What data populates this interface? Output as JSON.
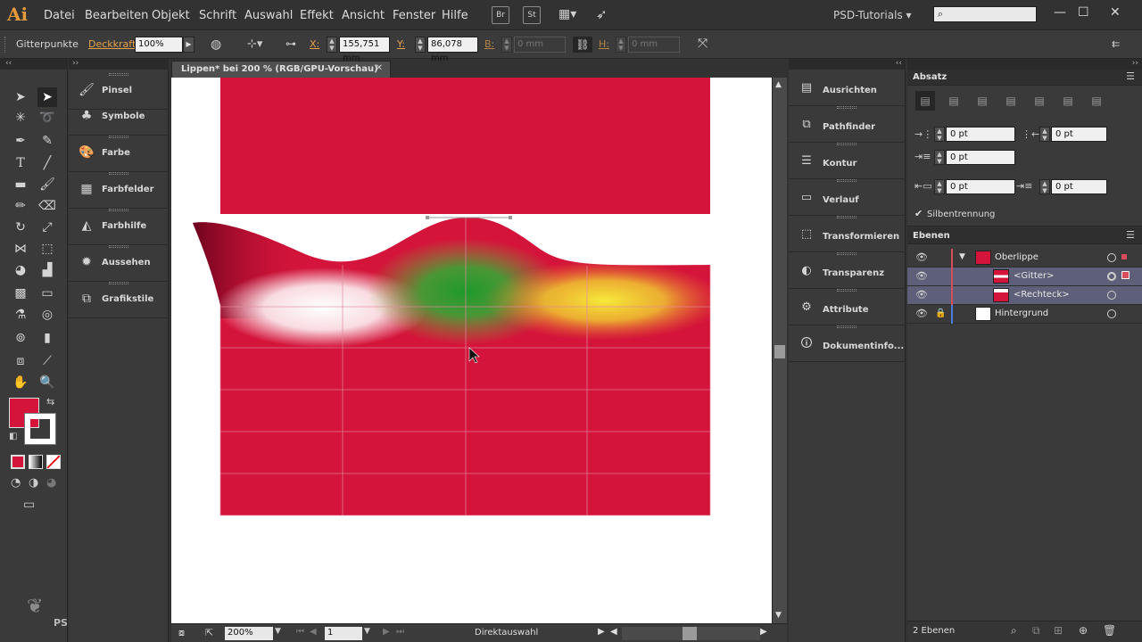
{
  "app": {
    "logo": "Ai",
    "menus": [
      "Datei",
      "Bearbeiten",
      "Objekt",
      "Schrift",
      "Auswahl",
      "Effekt",
      "Ansicht",
      "Fenster",
      "Hilfe"
    ],
    "bridge_icon": "Br",
    "stock_icon": "St",
    "workspace": "PSD-Tutorials",
    "window_controls": [
      "minimize-icon",
      "maximize-icon",
      "close-icon"
    ]
  },
  "control": {
    "selection_label": "Gitterpunkte",
    "opacity_label": "Deckkraft:",
    "opacity_value": "100%",
    "x_label": "X:",
    "x_value": "155,751 mm",
    "y_label": "Y:",
    "y_value": "86,078 mm",
    "w_label": "B:",
    "w_value": "0 mm",
    "h_label": "H:",
    "h_value": "0 mm"
  },
  "document": {
    "tab_title": "Lippen* bei 200 % (RGB/GPU-Vorschau)",
    "zoom": "200%",
    "artboard": "1",
    "status": "Direktauswahl",
    "colors": {
      "red": "#d4143a",
      "green": "#1e9a2a",
      "yellow": "#f2e23a"
    }
  },
  "panels_left": [
    {
      "label": "Pinsel",
      "icon": "brush-icon"
    },
    {
      "label": "Symbole",
      "icon": "symbols-icon"
    },
    {
      "label": "Farbe",
      "icon": "palette-icon"
    },
    {
      "label": "Farbfelder",
      "icon": "swatches-icon"
    },
    {
      "label": "Farbhilfe",
      "icon": "color-guide-icon"
    },
    {
      "label": "Aussehen",
      "icon": "appearance-icon"
    },
    {
      "label": "Grafikstile",
      "icon": "graphic-styles-icon"
    }
  ],
  "panels_right": [
    {
      "label": "Ausrichten",
      "icon": "align-icon"
    },
    {
      "label": "Pathfinder",
      "icon": "pathfinder-icon"
    },
    {
      "label": "Kontur",
      "icon": "stroke-icon"
    },
    {
      "label": "Verlauf",
      "icon": "gradient-icon"
    },
    {
      "label": "Transformieren",
      "icon": "transform-icon"
    },
    {
      "label": "Transparenz",
      "icon": "transparency-icon"
    },
    {
      "label": "Attribute",
      "icon": "attributes-icon"
    },
    {
      "label": "Dokumentinfo...",
      "icon": "document-info-icon"
    }
  ],
  "absatz": {
    "title": "Absatz",
    "left_indent": "0 pt",
    "right_indent": "0 pt",
    "first_line_indent": "0 pt",
    "space_before": "0 pt",
    "space_after": "0 pt",
    "hyphenation_label": "Silbentrennung"
  },
  "ebenen": {
    "title": "Ebenen",
    "layers": [
      {
        "name": "Oberlippe",
        "level": 0,
        "selected": false
      },
      {
        "name": "<Gitter>",
        "level": 1,
        "selected": true
      },
      {
        "name": "<Rechteck>",
        "level": 1,
        "selected": true
      },
      {
        "name": "Hintergrund",
        "level": 0,
        "selected": false
      }
    ],
    "count": "2 Ebenen"
  },
  "watermark": "PSD-Tutorials.de"
}
